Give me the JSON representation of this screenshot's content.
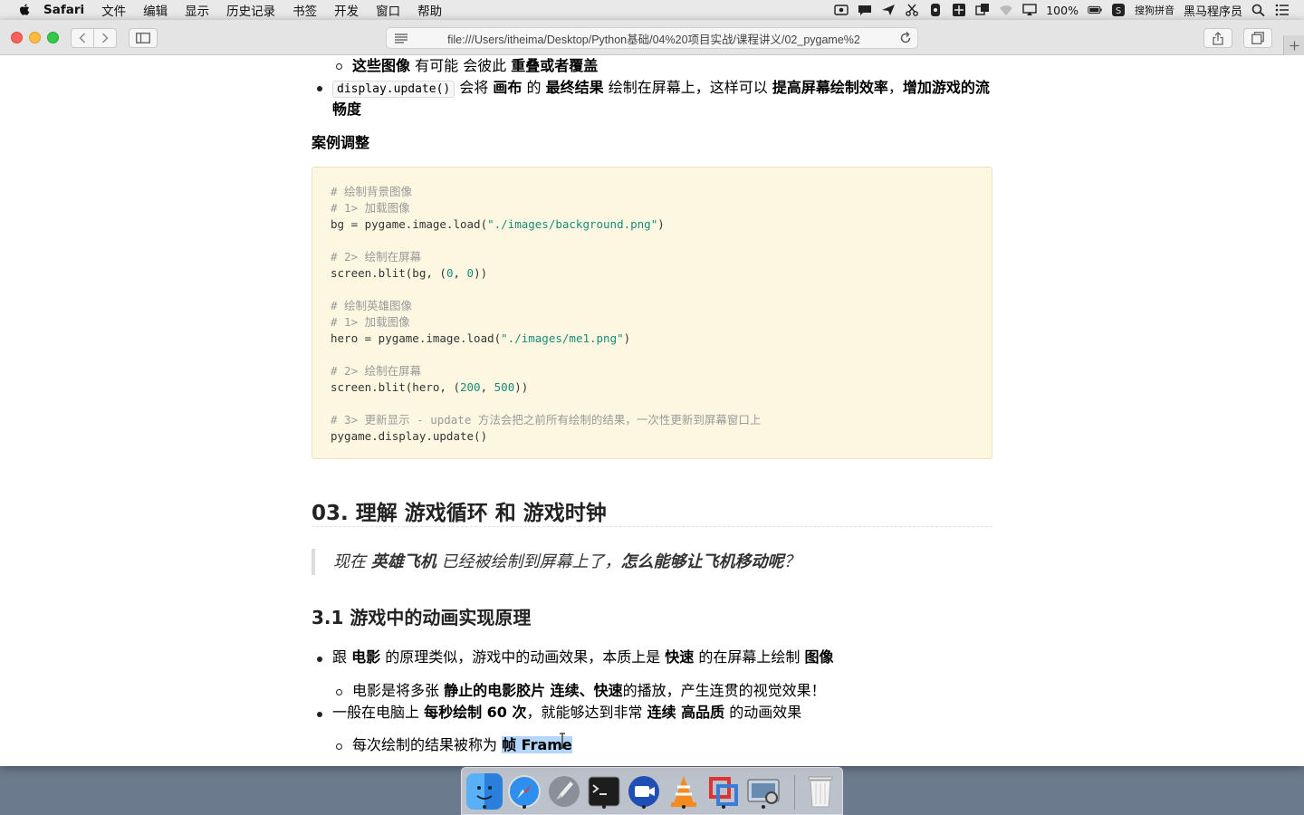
{
  "menubar": {
    "app": "Safari",
    "items": [
      "文件",
      "编辑",
      "显示",
      "历史记录",
      "书签",
      "开发",
      "窗口",
      "帮助"
    ],
    "battery": "100%",
    "input_method": "搜狗拼音",
    "user": "黑马程序员"
  },
  "browser": {
    "url": "file:///Users/itheima/Desktop/Python基础/04%20项目实战/课程讲义/02_pygame%2"
  },
  "doc": {
    "top_sub_bullet": {
      "b1": "这些图像",
      "t1": " 有可能 会彼此 ",
      "b2": "重叠或者覆盖"
    },
    "update_bullet": {
      "code": "display.update()",
      "t1": " 会将 ",
      "b1": "画布",
      "t2": " 的 ",
      "b2": "最终结果",
      "t3": " 绘制在屏幕上，这样可以 ",
      "b3": "提高屏幕绘制效率",
      "t4": "，",
      "b4": "增加游戏的流",
      "b5": "畅度"
    },
    "case_heading": "案例调整",
    "code": {
      "l1": "# 绘制背景图像",
      "l2": "# 1> 加载图像",
      "l3a": "bg = pygame.image.load(",
      "l3s": "\"./images/background.png\"",
      "l3b": ")",
      "l4": "# 2> 绘制在屏幕",
      "l5a": "screen.blit(bg, (",
      "l5n1": "0",
      "l5c": ", ",
      "l5n2": "0",
      "l5b": "))",
      "l6": "# 绘制英雄图像",
      "l7": "# 1> 加载图像",
      "l8a": "hero = pygame.image.load(",
      "l8s": "\"./images/me1.png\"",
      "l8b": ")",
      "l9": "# 2> 绘制在屏幕",
      "l10a": "screen.blit(hero, (",
      "l10n1": "200",
      "l10c": ", ",
      "l10n2": "500",
      "l10b": "))",
      "l11": "# 3> 更新显示 - update 方法会把之前所有绘制的结果，一次性更新到屏幕窗口上",
      "l12": "pygame.display.update()"
    },
    "h2": "03. 理解 游戏循环 和 游戏时钟",
    "quote": {
      "t1": "现在 ",
      "b1": "英雄飞机",
      "t2": " 已经被绘制到屏幕上了，",
      "b2": "怎么能够让飞机移动呢",
      "t3": "？"
    },
    "h3": "3.1 游戏中的动画实现原理",
    "bullet1": {
      "t1": "跟 ",
      "b1": "电影",
      "t2": " 的原理类似，游戏中的动画效果，本质上是 ",
      "b2": "快速",
      "t3": " 的在屏幕上绘制 ",
      "b3": "图像"
    },
    "sub1": {
      "t1": "电影是将多张 ",
      "b1": "静止的电影胶片 连续、快速",
      "t2": "的播放，产生连贯的视觉效果！"
    },
    "bullet2": {
      "t1": "一般在电脑上 ",
      "b1": "每秒绘制 60 次",
      "t2": "，就能够达到非常 ",
      "b2": "连续 高品质",
      "t3": " 的动画效果"
    },
    "sub2": {
      "t1": "每次绘制的结果被称为 ",
      "b1": "帧 Frame"
    }
  },
  "colors": {
    "code_bg": "#fdf7e2",
    "selection": "#b4d6fb",
    "string": "#1a8a7a",
    "comment": "#9a9a9a"
  }
}
